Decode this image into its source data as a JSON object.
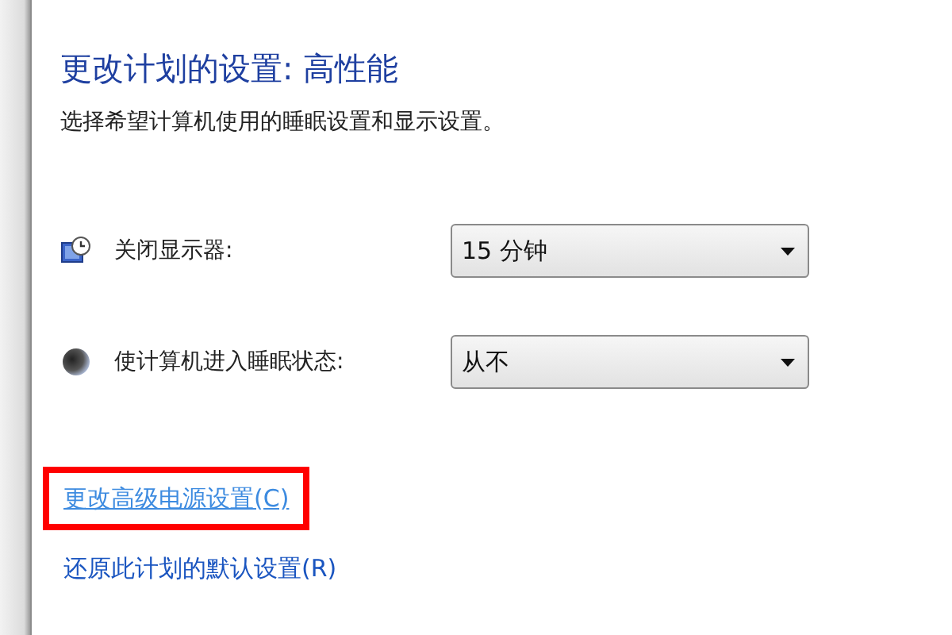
{
  "title": "更改计划的设置: 高性能",
  "description": "选择希望计算机使用的睡眠设置和显示设置。",
  "settings": [
    {
      "kind": "display",
      "label": "关闭显示器:",
      "value": "15 分钟"
    },
    {
      "kind": "sleep",
      "label": "使计算机进入睡眠状态:",
      "value": "从不"
    }
  ],
  "links": [
    {
      "text": "更改高级电源设置(C)",
      "hovered": true,
      "highlighted": true
    },
    {
      "text": "还原此计划的默认设置(R)",
      "hovered": false,
      "highlighted": false
    }
  ]
}
